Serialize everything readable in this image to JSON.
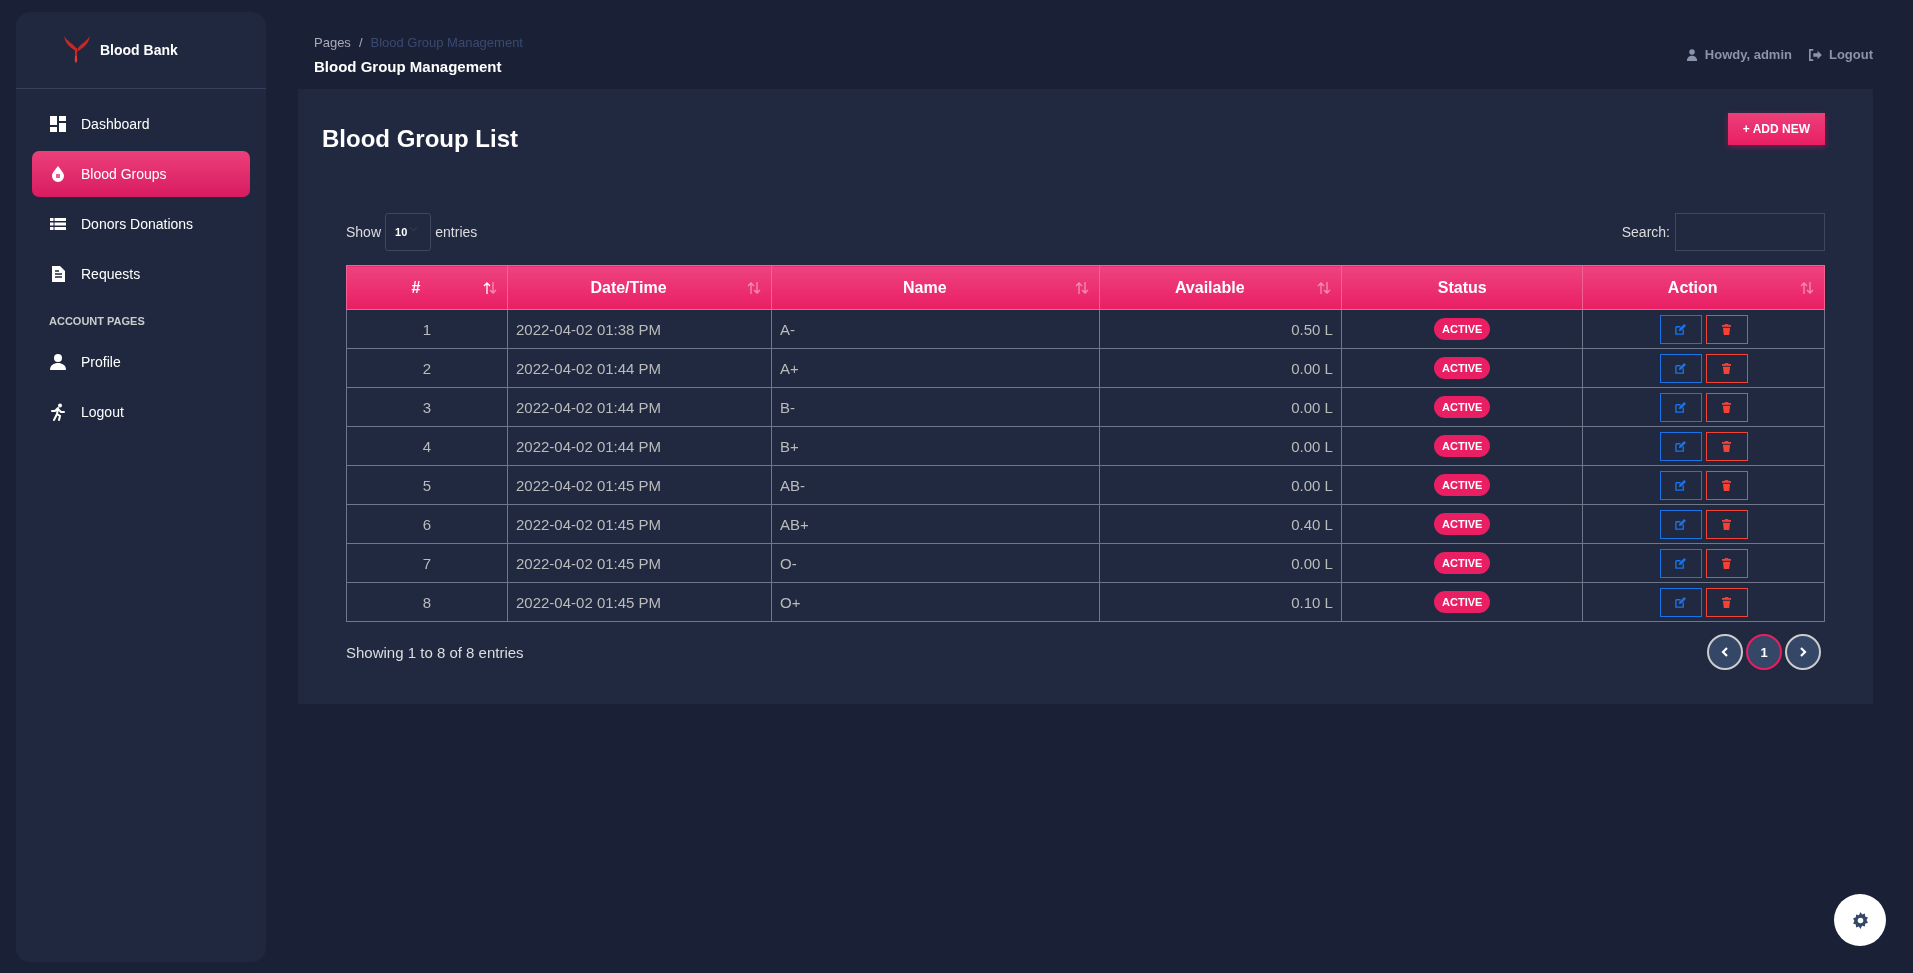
{
  "sidebar": {
    "brand": "Blood Bank",
    "items": [
      {
        "label": "Dashboard",
        "selected": false
      },
      {
        "label": "Blood Groups",
        "selected": true
      },
      {
        "label": "Donors Donations",
        "selected": false
      },
      {
        "label": "Requests",
        "selected": false
      }
    ],
    "section_heading": "ACCOUNT PAGES",
    "account_items": [
      {
        "label": "Profile",
        "selected": false
      },
      {
        "label": "Logout",
        "selected": false
      }
    ]
  },
  "header": {
    "breadcrumb": [
      "Pages",
      "Blood Group Management"
    ],
    "breadcrumb_separator": "/",
    "page_title": "Blood Group Management",
    "user_greeting": "Howdy, admin",
    "logout": "Logout"
  },
  "card": {
    "title": "Blood Group List",
    "add_button": "+ ADD NEW",
    "length": {
      "show": "Show",
      "value": "10",
      "entries": "entries"
    },
    "search": {
      "label": "Search:"
    },
    "table": {
      "columns": [
        {
          "label": "#",
          "kind": "sortable",
          "sorted": true
        },
        {
          "label": "Date/Time",
          "kind": "sortable",
          "sorted": false
        },
        {
          "label": "Name",
          "kind": "sortable",
          "sorted": false
        },
        {
          "label": "Available",
          "kind": "sortable",
          "sorted": false
        },
        {
          "label": "Status",
          "kind": "plain"
        },
        {
          "label": "Action",
          "kind": "sortable",
          "sorted": false
        }
      ],
      "rows": [
        {
          "cells": [
            "1",
            "2022-04-02 01:38 PM",
            "A-",
            "0.50 L"
          ],
          "status": "ACTIVE"
        },
        {
          "cells": [
            "2",
            "2022-04-02 01:44 PM",
            "A+",
            "0.00 L"
          ],
          "status": "ACTIVE"
        },
        {
          "cells": [
            "3",
            "2022-04-02 01:44 PM",
            "B-",
            "0.00 L"
          ],
          "status": "ACTIVE"
        },
        {
          "cells": [
            "4",
            "2022-04-02 01:44 PM",
            "B+",
            "0.00 L"
          ],
          "status": "ACTIVE"
        },
        {
          "cells": [
            "5",
            "2022-04-02 01:45 PM",
            "AB-",
            "0.00 L"
          ],
          "status": "ACTIVE"
        },
        {
          "cells": [
            "6",
            "2022-04-02 01:45 PM",
            "AB+",
            "0.40 L"
          ],
          "status": "ACTIVE"
        },
        {
          "cells": [
            "7",
            "2022-04-02 01:45 PM",
            "O-",
            "0.00 L"
          ],
          "status": "ACTIVE"
        },
        {
          "cells": [
            "8",
            "2022-04-02 01:45 PM",
            "O+",
            "0.10 L"
          ],
          "status": "ACTIVE"
        }
      ]
    },
    "info": "Showing 1 to 8 of 8 entries",
    "pagination": [
      {
        "kind": "prev",
        "selected": false
      },
      {
        "kind": "page",
        "label": "1",
        "selected": true
      },
      {
        "kind": "next",
        "selected": false
      }
    ]
  }
}
